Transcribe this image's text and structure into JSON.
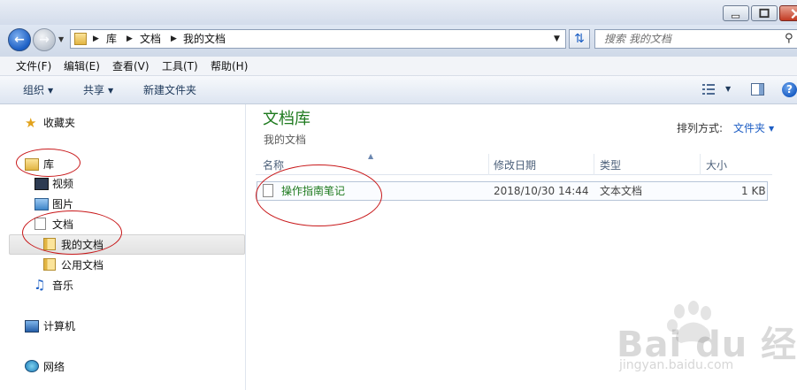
{
  "address": {
    "crumbs": [
      "库",
      "文档",
      "我的文档"
    ],
    "search_placeholder": "搜索 我的文档"
  },
  "menu": [
    "文件(F)",
    "编辑(E)",
    "查看(V)",
    "工具(T)",
    "帮助(H)"
  ],
  "commands": {
    "organize": "组织",
    "share": "共享",
    "new_folder": "新建文件夹"
  },
  "nav": {
    "favorites": "收藏夹",
    "libraries": "库",
    "videos": "视频",
    "pictures": "图片",
    "documents": "文档",
    "my_documents": "我的文档",
    "public_documents": "公用文档",
    "music": "音乐",
    "computer": "计算机",
    "network": "网络"
  },
  "library": {
    "title": "文档库",
    "subtitle": "我的文档",
    "arrange_label": "排列方式:",
    "arrange_value": "文件夹"
  },
  "columns": [
    "名称",
    "修改日期",
    "类型",
    "大小"
  ],
  "files": [
    {
      "name": "操作指南笔记",
      "modified": "2018/10/30 14:44",
      "type": "文本文档",
      "size": "1 KB"
    }
  ],
  "watermark": {
    "brand": "Bai du 经验",
    "url": "jingyan.baidu.com"
  },
  "colors": {
    "accent_green": "#1e7a1e",
    "link_blue": "#1e5ec4",
    "annotation_red": "#c8181a"
  }
}
